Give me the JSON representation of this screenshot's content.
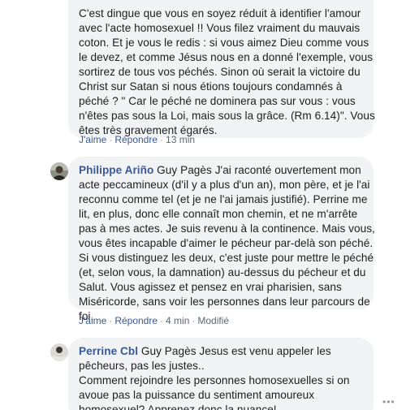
{
  "comments": [
    {
      "author": "",
      "text_lines": [
        "C'est dingue que vous en soyez réduit à identifier l'amour",
        "avec l'acte homosexuel !! Vous filez vraiment du mauvais",
        "coton. Et je vous le redis : si vous aimez Dieu comme vous",
        "le devez, et comme Jésus nous en a donné l'exemple, vous",
        "sortirez de tous vos péchés. Sinon où serait la victoire du",
        "Christ sur Satan si nous étions toujours condamnés à",
        "péché ? \" Car le péché ne dominera pas sur vous : vous",
        "n'êtes pas sous la Loi, mais sous la grâce. (Rm 6.14)\". Vous",
        "êtes très gravement égarés."
      ],
      "like_label": "J'aime",
      "reply_label": "Répondre",
      "time": "13 min"
    },
    {
      "author": "Philippe Ariño",
      "first_line_rest": " Guy Pagès J'ai raconté ouvertement mon",
      "text_lines": [
        "acte peccamineux (d'il y a plus d'un an), mon père, et je l'ai",
        "reconnu comme tel (et je ne l'ai jamais justifié). Perrine me",
        "lit, en plus, donc elle connaît mon chemin, et ne m'arrête",
        "pas à mes actes. Je suis revenu à la continence. Mais vous,",
        "vous êtes incapable d'aimer le pécheur par-delà son péché.",
        "Si vous distinguez les deux, c'est juste pour mettre le péché",
        "(et, selon vous, la damnation) au-dessus du pécheur et du",
        "Salut. Vous agissez et pensez en vrai pharisien, sans",
        "Miséricorde, sans voir les personnes dans leur parcours de",
        "foi."
      ],
      "like_label": "J'aime",
      "reply_label": "Répondre",
      "time": "4 min",
      "edited_label": "Modifié"
    },
    {
      "author": "Perrine Cbl",
      "first_line_rest": " Guy Pagès Jesus est venu appeler les",
      "text_lines": [
        "pêcheurs, pas les justes..",
        "Comment rejoindre les personnes homosexuelles si on",
        "avoue pas la puissance du sentiment amoureux",
        "homosexuel? Apprenez donc la nuance!"
      ],
      "more_icon": "•••"
    }
  ],
  "colors": {
    "bubble": "#f2f3f5",
    "author": "#385898",
    "text": "#1c1e21",
    "meta": "#606770"
  }
}
